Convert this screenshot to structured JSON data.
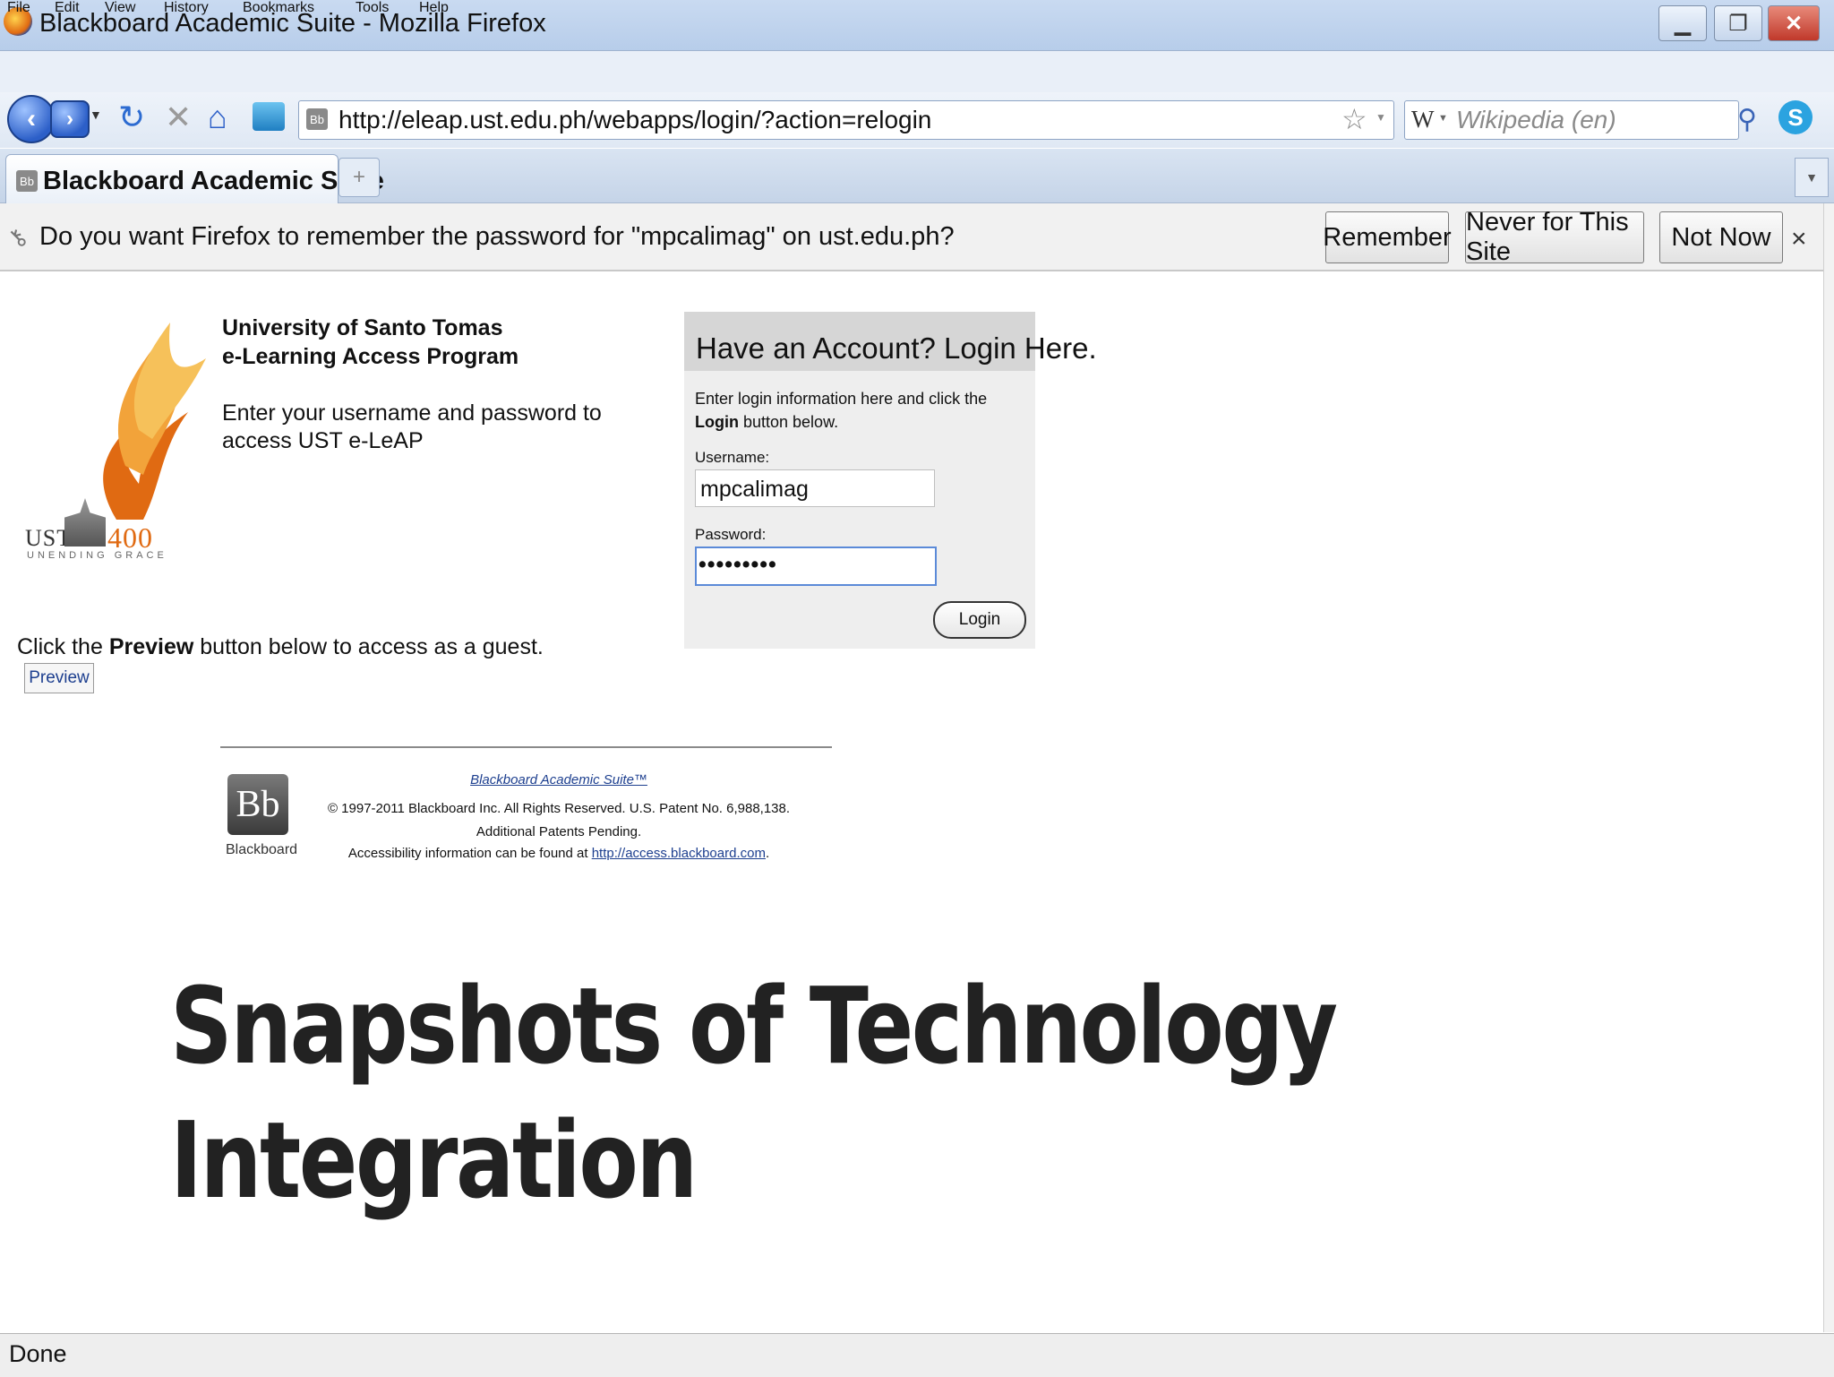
{
  "window": {
    "title": "Blackboard Academic Suite - Mozilla Firefox",
    "controls": {
      "minimize": "▁",
      "restore": "❐",
      "close": "✕"
    }
  },
  "menu": [
    "File",
    "Edit",
    "View",
    "History",
    "Bookmarks",
    "Tools",
    "Help"
  ],
  "toolbar": {
    "url": "http://eleap.ust.edu.ph/webapps/login/?action=relogin",
    "search_placeholder": "Wikipedia (en)",
    "search_engine_letter": "W"
  },
  "tab": {
    "label": "Blackboard Academic Suite",
    "favicon": "Bb",
    "new_tab_symbol": "+"
  },
  "notification": {
    "message": "Do you want Firefox to remember the password for \"mpcalimag\" on ust.edu.ph?",
    "remember": "Remember",
    "never": "Never for This Site",
    "not_now": "Not Now",
    "close": "×"
  },
  "page": {
    "logo": {
      "ust": "UST",
      "years": "400",
      "tagline": "UNENDING GRACE"
    },
    "university_line1": "University of Santo Tomas",
    "university_line2": "e-Learning Access Program",
    "intro": "Enter your username and password to access UST e-LeAP",
    "login": {
      "title": "Have an Account? Login Here.",
      "instructions_pre": "Enter login information here and click the ",
      "instructions_bold": "Login",
      "instructions_post": " button below.",
      "username_label": "Username:",
      "username_value": "mpcalimag",
      "password_label": "Password:",
      "password_value": "•••••••••",
      "button": "Login"
    },
    "guest_pre": "Click the ",
    "guest_bold": "Preview",
    "guest_post": " button below to access as a guest.",
    "preview_button": "Preview",
    "footer": {
      "logo_letters": "Bb",
      "logo_word": "Blackboard",
      "product_link": "Blackboard Academic Suite™",
      "copyright": "© 1997-2011 Blackboard Inc. All Rights Reserved. U.S. Patent No. 6,988,138. Additional Patents Pending.",
      "access_pre": "Accessibility information can be found at ",
      "access_link": "http://access.blackboard.com",
      "access_post": "."
    }
  },
  "overlay": {
    "line1": "Snapshots of Technology",
    "line2": "Integration"
  },
  "status": "Done",
  "colors": {
    "titlebar": "#c9daf1",
    "accent": "#2c5fc8",
    "link": "#1d3f8f",
    "flame": "#e06a12"
  }
}
